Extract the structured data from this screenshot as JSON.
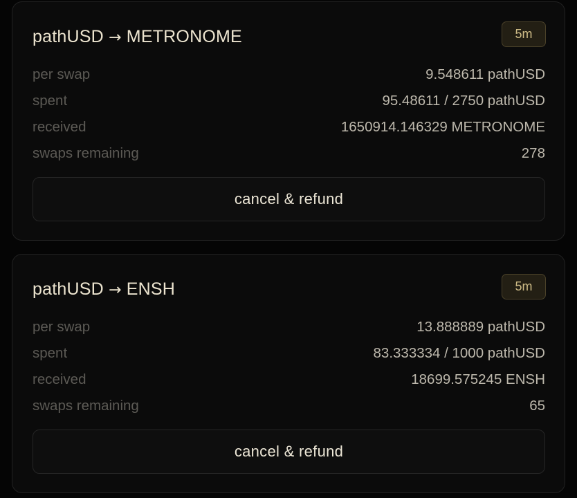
{
  "orders": [
    {
      "from_token": "pathUSD",
      "arrow": "→",
      "to_token": "METRONOME",
      "interval_badge": "5m",
      "rows": [
        {
          "label": "per swap",
          "value": "9.548611 pathUSD"
        },
        {
          "label": "spent",
          "value": "95.48611 / 2750 pathUSD"
        },
        {
          "label": "received",
          "value": "1650914.146329 METRONOME"
        },
        {
          "label": "swaps remaining",
          "value": "278"
        }
      ],
      "action_label": "cancel & refund"
    },
    {
      "from_token": "pathUSD",
      "arrow": "→",
      "to_token": "ENSH",
      "interval_badge": "5m",
      "rows": [
        {
          "label": "per swap",
          "value": "13.888889 pathUSD"
        },
        {
          "label": "spent",
          "value": "83.333334 / 1000 pathUSD"
        },
        {
          "label": "received",
          "value": "18699.575245 ENSH"
        },
        {
          "label": "swaps remaining",
          "value": "65"
        }
      ],
      "action_label": "cancel & refund"
    }
  ],
  "colors": {
    "background": "#050505",
    "card": "#0b0b0b",
    "badge_text": "#cdbb86",
    "title_text": "#ece4cf"
  }
}
